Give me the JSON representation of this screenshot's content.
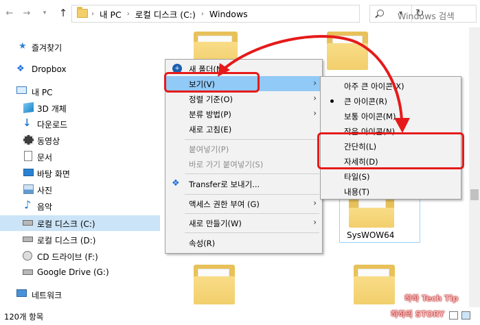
{
  "address_bar": {
    "breadcrumbs": [
      "내 PC",
      "로컬 디스크 (C:)",
      "Windows"
    ],
    "search_placeholder": "Windows 검색"
  },
  "sidebar": {
    "items": [
      {
        "label": "즐겨찾기",
        "icon": "star-icon"
      },
      {
        "label": "Dropbox",
        "icon": "dropbox-icon"
      },
      {
        "label": "내 PC",
        "icon": "pc-icon"
      },
      {
        "label": "3D 개체",
        "icon": "cube-3d-icon"
      },
      {
        "label": "다운로드",
        "icon": "download-icon"
      },
      {
        "label": "동영상",
        "icon": "video-icon"
      },
      {
        "label": "문서",
        "icon": "document-icon"
      },
      {
        "label": "바탕 화면",
        "icon": "desktop-icon"
      },
      {
        "label": "사진",
        "icon": "picture-icon"
      },
      {
        "label": "음악",
        "icon": "music-icon"
      },
      {
        "label": "로컬 디스크 (C:)",
        "icon": "drive-icon",
        "selected": true
      },
      {
        "label": "로컬 디스크 (D:)",
        "icon": "drive-icon"
      },
      {
        "label": "CD 드라이브 (F:)",
        "icon": "cd-drive-icon"
      },
      {
        "label": "Google Drive (G:)",
        "icon": "drive-icon"
      },
      {
        "label": "네트워크",
        "icon": "network-icon"
      }
    ]
  },
  "content": {
    "visible_folder_label": "SysWOW64"
  },
  "status_bar": {
    "item_count": "120개 항목"
  },
  "context_menu": {
    "items": [
      {
        "label": "새 폴더(N)",
        "icon": "new-folder-icon"
      },
      {
        "label": "보기(V)",
        "submenu": true,
        "highlighted": true
      },
      {
        "label": "정렬 기준(O)",
        "submenu": true
      },
      {
        "label": "분류 방법(P)",
        "submenu": true
      },
      {
        "label": "새로 고침(E)"
      },
      {
        "label": "붙여넣기(P)",
        "disabled": true
      },
      {
        "label": "바로 가기 붙여넣기(S)",
        "disabled": true
      },
      {
        "label": "Transfer로 보내기...",
        "icon": "dropbox-icon"
      },
      {
        "label": "액세스 권한 부여 (G)",
        "submenu": true
      },
      {
        "label": "새로 만들기(W)",
        "submenu": true
      },
      {
        "label": "속성(R)"
      }
    ]
  },
  "view_submenu": {
    "items": [
      {
        "label": "아주 큰 아이콘(X)"
      },
      {
        "label": "큰 아이콘(R)",
        "checked": true
      },
      {
        "label": "보통 아이콘(M)"
      },
      {
        "label": "작은 아이콘(N)"
      },
      {
        "label": "간단히(L)"
      },
      {
        "label": "자세히(D)"
      },
      {
        "label": "타일(S)"
      },
      {
        "label": "내용(T)"
      }
    ]
  },
  "annotation": {
    "color": "#e61a1a"
  },
  "watermark": {
    "line1": "하하 Tech Tip",
    "line2": "하하의 STORY"
  }
}
